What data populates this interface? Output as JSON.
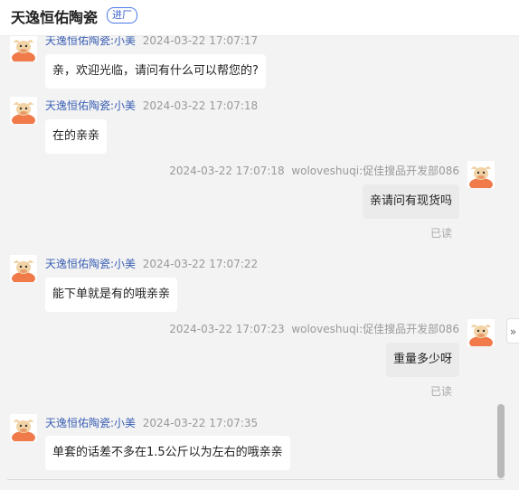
{
  "header": {
    "shop_name": "天逸恒佑陶瓷",
    "badge": "进厂"
  },
  "messages": [
    {
      "sender": "天逸恒佑陶瓷:小美",
      "time": "2024-03-22 17:07:17",
      "text": "亲，欢迎光临，请问有什么可以帮您的?"
    },
    {
      "sender": "天逸恒佑陶瓷:小美",
      "time": "2024-03-22 17:07:18",
      "text": "在的亲亲"
    },
    {
      "sender": "woloveshuqi:促佳搜品开发部086",
      "time": "2024-03-22 17:07:18",
      "text": "亲请问有现货吗",
      "status": "已读"
    },
    {
      "sender": "天逸恒佑陶瓷:小美",
      "time": "2024-03-22 17:07:22",
      "text": "能下单就是有的哦亲亲"
    },
    {
      "sender": "woloveshuqi:促佳搜品开发部086",
      "time": "2024-03-22 17:07:23",
      "text": "重量多少呀",
      "status": "已读"
    },
    {
      "sender": "天逸恒佑陶瓷:小美",
      "time": "2024-03-22 17:07:35",
      "text": "单套的话差不多在1.5公斤以为左右的哦亲亲"
    }
  ],
  "icons": {
    "avatar": "cartoon-cow-avatar-icon",
    "expand": "double-chevron-right-icon"
  },
  "colors": {
    "sender_name": "#3a5fb4",
    "avatar_orange": "#f07a4a",
    "badge_border": "#4a78e8"
  }
}
